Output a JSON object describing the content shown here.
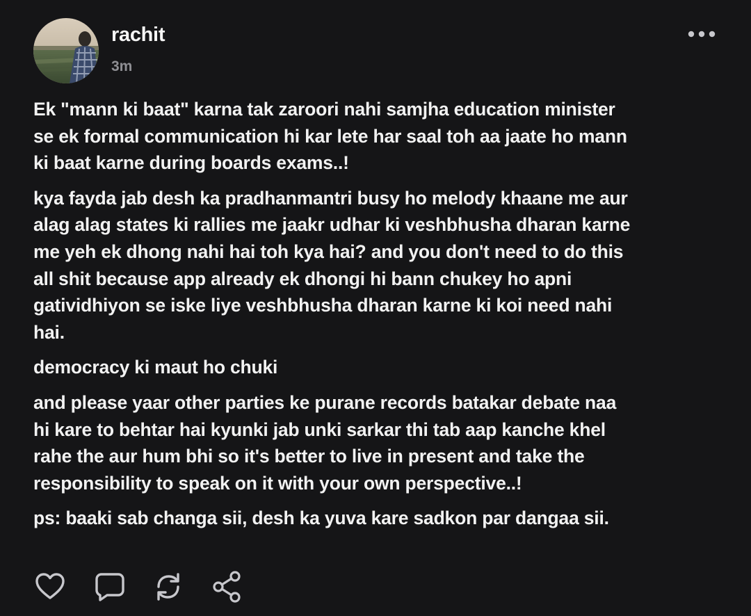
{
  "post": {
    "author": "rachit",
    "time": "3m",
    "paragraphs": [
      "Ek \"mann ki baat\" karna tak zaroori nahi samjha education minister\nse ek formal communication hi kar lete har saal toh aa jaate ho mann\nki baat karne during boards exams..!",
      "kya fayda jab desh ka pradhanmantri busy ho melody khaane me aur\nalag alag states ki rallies me jaakr udhar ki veshbhusha dharan karne\nme yeh ek dhong nahi hai toh kya hai? and you don't need to do this\nall shit because app already ek dhongi hi bann chukey ho apni\ngatividhiyon se iske liye veshbhusha dharan karne ki koi need nahi\nhai.",
      "democracy ki maut ho chuki",
      "and please yaar other parties ke purane records batakar debate naa\nhi kare to behtar hai kyunki jab unki sarkar thi tab aap kanche khel\nrahe the aur hum bhi so it's better to live in present and take the\nresponsibility to speak on it with your own perspective..!",
      "ps: baaki sab changa sii, desh ka yuva kare sadkon par dangaa sii."
    ]
  },
  "icons": {
    "more": "more-horizontal-icon",
    "like": "heart-icon",
    "reply": "comment-icon",
    "repost": "repost-icon",
    "share": "share-icon"
  },
  "colors": {
    "background": "#151517",
    "text": "#f2f2f2",
    "muted": "#8e8e93",
    "icon": "#c7c7cc"
  }
}
